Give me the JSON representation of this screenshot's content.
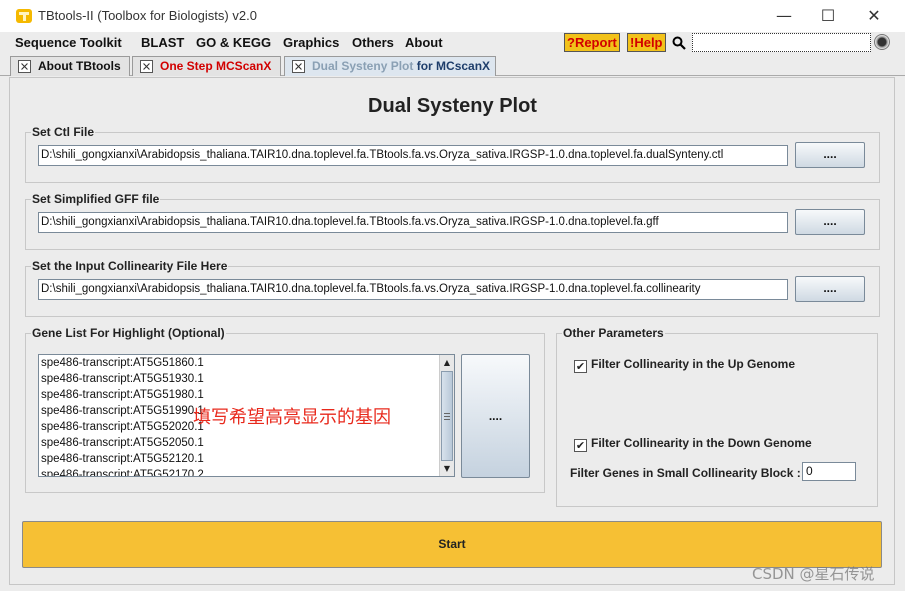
{
  "window": {
    "title": "TBtools-II (Toolbox for Biologists) v2.0",
    "minimize_glyph": "—",
    "maximize_glyph": "☐",
    "close_glyph": "✕"
  },
  "menu": {
    "items": [
      "Sequence Toolkit",
      "BLAST",
      "GO & KEGG",
      "Graphics",
      "Others",
      "About"
    ],
    "report_label": "?Report",
    "help_label": "!Help"
  },
  "tabs": [
    {
      "prefix": "",
      "label": "About TBtools"
    },
    {
      "prefix": "One Step",
      "label": " MCScanX"
    },
    {
      "prefix": "Dual Systeny Plot",
      "label": " for MCscanX"
    }
  ],
  "page": {
    "heading": "Dual Systeny Plot",
    "ctl": {
      "title": "Set Ctl File",
      "value": "D:\\shili_gongxianxi\\Arabidopsis_thaliana.TAIR10.dna.toplevel.fa.TBtools.fa.vs.Oryza_sativa.IRGSP-1.0.dna.toplevel.fa.dualSynteny.ctl",
      "button": "...."
    },
    "gff": {
      "title": "Set Simplified GFF file",
      "value": "D:\\shili_gongxianxi\\Arabidopsis_thaliana.TAIR10.dna.toplevel.fa.TBtools.fa.vs.Oryza_sativa.IRGSP-1.0.dna.toplevel.fa.gff",
      "button": "...."
    },
    "collinearity": {
      "title": "Set the Input Collinearity File Here",
      "value": "D:\\shili_gongxianxi\\Arabidopsis_thaliana.TAIR10.dna.toplevel.fa.TBtools.fa.vs.Oryza_sativa.IRGSP-1.0.dna.toplevel.fa.collinearity",
      "button": "...."
    },
    "gene_list": {
      "title": "Gene List For Highlight (Optional)",
      "items": [
        "spe486-transcript:AT5G51860.1",
        "spe486-transcript:AT5G51930.1",
        "spe486-transcript:AT5G51980.1",
        "spe486-transcript:AT5G51990.1",
        "spe486-transcript:AT5G52020.1",
        "spe486-transcript:AT5G52050.1",
        "spe486-transcript:AT5G52120.1",
        "spe486-transcript:AT5G52170.2"
      ],
      "annotation": "填写希望高亮显示的基因",
      "button": "...."
    },
    "other_params": {
      "title": "Other Parameters",
      "filter_up_label": "Filter Collinearity in the Up Genome",
      "filter_up_checked": true,
      "filter_down_label": "Filter Collinearity in the Down Genome",
      "filter_down_checked": true,
      "small_block_label": "Filter Genes in Small Collinearity Block :",
      "small_block_value": "0",
      "check_glyph": "✔"
    },
    "start_label": "Start"
  },
  "watermark": "CSDN @星石传说",
  "colors": {
    "report_bg": "#f2c21a",
    "report_text": "#d20000",
    "start_bg": "#f6c034",
    "annotation": "#e8291c"
  }
}
